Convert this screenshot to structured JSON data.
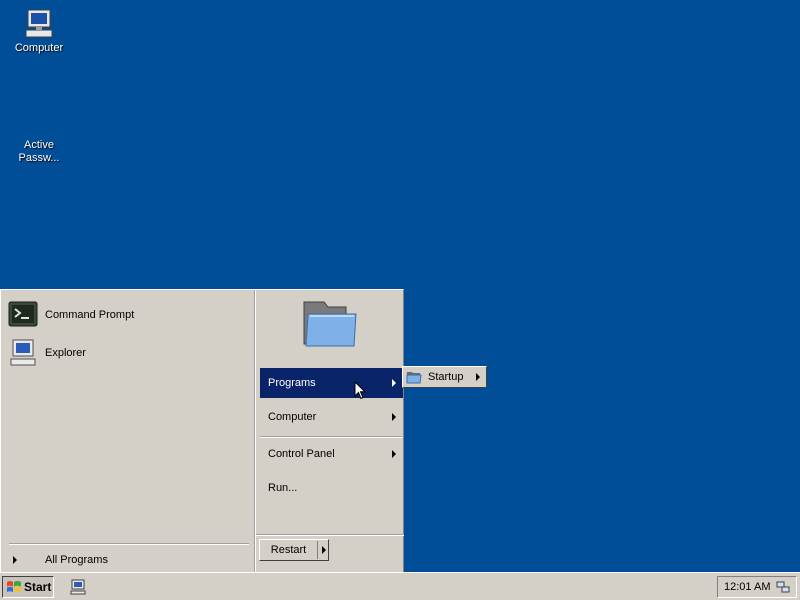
{
  "desktop": {
    "icons": [
      {
        "label": "Computer",
        "icon": "computer-icon"
      },
      {
        "label": "Active\nPassw...",
        "icon": "generic-app-icon"
      }
    ]
  },
  "start_menu": {
    "pinned": [
      {
        "label": "Command Prompt",
        "icon": "command-prompt-icon"
      },
      {
        "label": "Explorer",
        "icon": "explorer-icon"
      }
    ],
    "all_programs": "All Programs",
    "right_items": [
      {
        "label": "Programs",
        "selected": true
      },
      {
        "label": "Computer",
        "selected": false
      },
      {
        "label": "Control Panel",
        "selected": false
      },
      {
        "label": "Run...",
        "selected": false
      }
    ],
    "restart": "Restart"
  },
  "submenu": {
    "label": "Startup",
    "icon": "folder-icon"
  },
  "taskbar": {
    "start": "Start",
    "clock": "12:01 AM"
  },
  "colors": {
    "desktop": "#004e98",
    "selection": "#0a246a",
    "chrome": "#d4d0c8"
  }
}
